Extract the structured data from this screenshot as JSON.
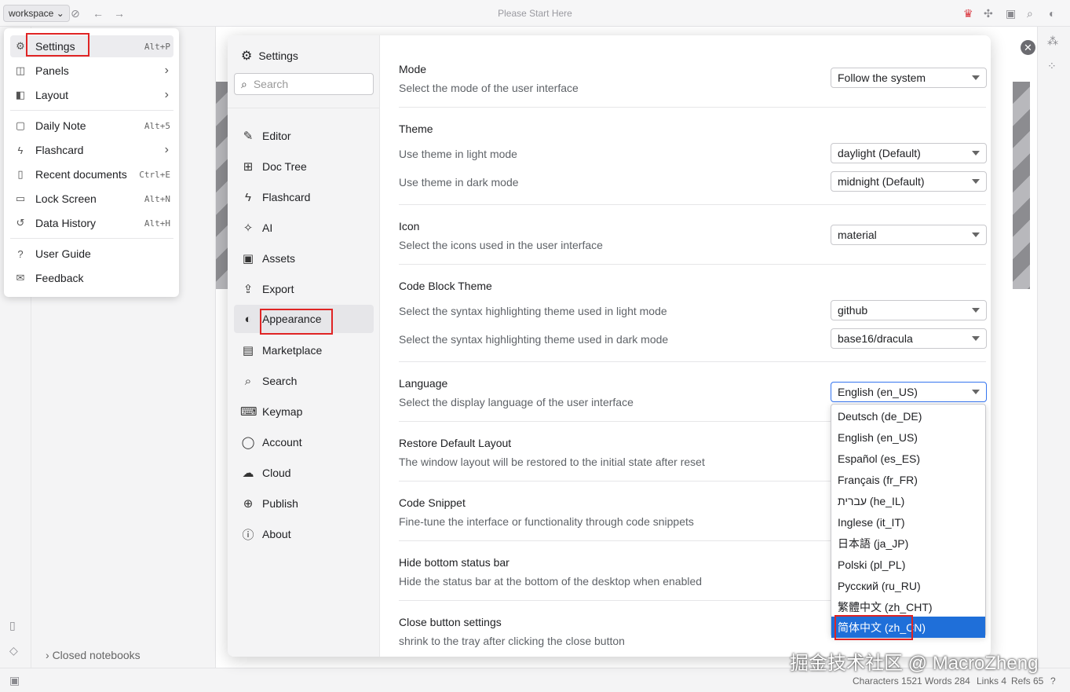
{
  "topbar": {
    "workspace": "workspace",
    "title": "Please Start Here"
  },
  "menu": {
    "items": [
      {
        "icon": "gear-icon",
        "glyph": "⚙",
        "label": "Settings",
        "shortcut": "Alt+P",
        "arrow": ""
      },
      {
        "icon": "panels-icon",
        "glyph": "◫",
        "label": "Panels",
        "shortcut": "",
        "arrow": "›"
      },
      {
        "icon": "layout-icon",
        "glyph": "◧",
        "label": "Layout",
        "shortcut": "",
        "arrow": "›"
      },
      {
        "icon": "calendar-icon",
        "glyph": "▢",
        "label": "Daily Note",
        "shortcut": "Alt+5",
        "arrow": ""
      },
      {
        "icon": "flashcard-icon",
        "glyph": "ϟ",
        "label": "Flashcard",
        "shortcut": "",
        "arrow": "›"
      },
      {
        "icon": "document-icon",
        "glyph": "▯",
        "label": "Recent documents",
        "shortcut": "Ctrl+E",
        "arrow": ""
      },
      {
        "icon": "lock-icon",
        "glyph": "▭",
        "label": "Lock Screen",
        "shortcut": "Alt+N",
        "arrow": ""
      },
      {
        "icon": "history-icon",
        "glyph": "↺",
        "label": "Data History",
        "shortcut": "Alt+H",
        "arrow": ""
      },
      {
        "icon": "help-icon",
        "glyph": "?",
        "label": "User Guide",
        "shortcut": "",
        "arrow": ""
      },
      {
        "icon": "feedback-icon",
        "glyph": "✉",
        "label": "Feedback",
        "shortcut": "",
        "arrow": ""
      }
    ]
  },
  "settings": {
    "title": "Settings",
    "search_placeholder": "Search",
    "nav": [
      {
        "icon": "edit-icon",
        "glyph": "✎",
        "label": "Editor"
      },
      {
        "icon": "tree-icon",
        "glyph": "⊞",
        "label": "Doc Tree"
      },
      {
        "icon": "flashcard-icon",
        "glyph": "ϟ",
        "label": "Flashcard"
      },
      {
        "icon": "ai-icon",
        "glyph": "✧",
        "label": "AI"
      },
      {
        "icon": "image-icon",
        "glyph": "▣",
        "label": "Assets"
      },
      {
        "icon": "export-icon",
        "glyph": "⇪",
        "label": "Export"
      },
      {
        "icon": "palette-icon",
        "glyph": "◐",
        "label": "Appearance"
      },
      {
        "icon": "store-icon",
        "glyph": "▤",
        "label": "Marketplace"
      },
      {
        "icon": "search-icon",
        "glyph": "⌕",
        "label": "Search"
      },
      {
        "icon": "keyboard-icon",
        "glyph": "⌨",
        "label": "Keymap"
      },
      {
        "icon": "account-icon",
        "glyph": "◯",
        "label": "Account"
      },
      {
        "icon": "cloud-icon",
        "glyph": "☁",
        "label": "Cloud"
      },
      {
        "icon": "globe-icon",
        "glyph": "⊕",
        "label": "Publish"
      },
      {
        "icon": "info-icon",
        "glyph": "ⓘ",
        "label": "About"
      }
    ],
    "active_nav": "Appearance",
    "sections": {
      "mode": {
        "title": "Mode",
        "desc": "Select the mode of the user interface",
        "value": "Follow the system"
      },
      "theme": {
        "title": "Theme",
        "light_label": "Use theme in light mode",
        "light_value": "daylight (Default)",
        "dark_label": "Use theme in dark mode",
        "dark_value": "midnight (Default)"
      },
      "icon": {
        "title": "Icon",
        "desc": "Select the icons used in the user interface",
        "value": "material"
      },
      "code_block": {
        "title": "Code Block Theme",
        "light_label": "Select the syntax highlighting theme used in light mode",
        "light_value": "github",
        "dark_label": "Select the syntax highlighting theme used in dark mode",
        "dark_value": "base16/dracula"
      },
      "language": {
        "title": "Language",
        "desc": "Select the display language of the user interface",
        "value": "English (en_US)"
      },
      "restore": {
        "title": "Restore Default Layout",
        "desc": "The window layout will be restored to the initial state after reset"
      },
      "snippet": {
        "title": "Code Snippet",
        "desc": "Fine-tune the interface or functionality through code snippets"
      },
      "statusbar": {
        "title": "Hide bottom status bar",
        "desc": "Hide the status bar at the bottom of the desktop when enabled"
      },
      "close_btn": {
        "title": "Close button settings",
        "desc": "shrink to the tray after clicking the close button"
      }
    },
    "languages": [
      "Deutsch (de_DE)",
      "English (en_US)",
      "Español (es_ES)",
      "Français (fr_FR)",
      "עברית (he_IL)",
      "Inglese (it_IT)",
      "日本語 (ja_JP)",
      "Polski (pl_PL)",
      "Русский (ru_RU)",
      "繁體中文 (zh_CHT)",
      "简体中文 (zh_CN)"
    ],
    "selected_language": "简体中文 (zh_CN)"
  },
  "sidebar": {
    "closed_notebooks": "Closed notebooks"
  },
  "status": {
    "characters": "Characters 1521",
    "words": "Words 284",
    "links": "Links 4",
    "refs": "Refs 65"
  },
  "watermark": "掘金技术社区 @ MacroZheng",
  "colors": {
    "accent": "#1f6fd9",
    "highlight_box": "#e02424"
  }
}
